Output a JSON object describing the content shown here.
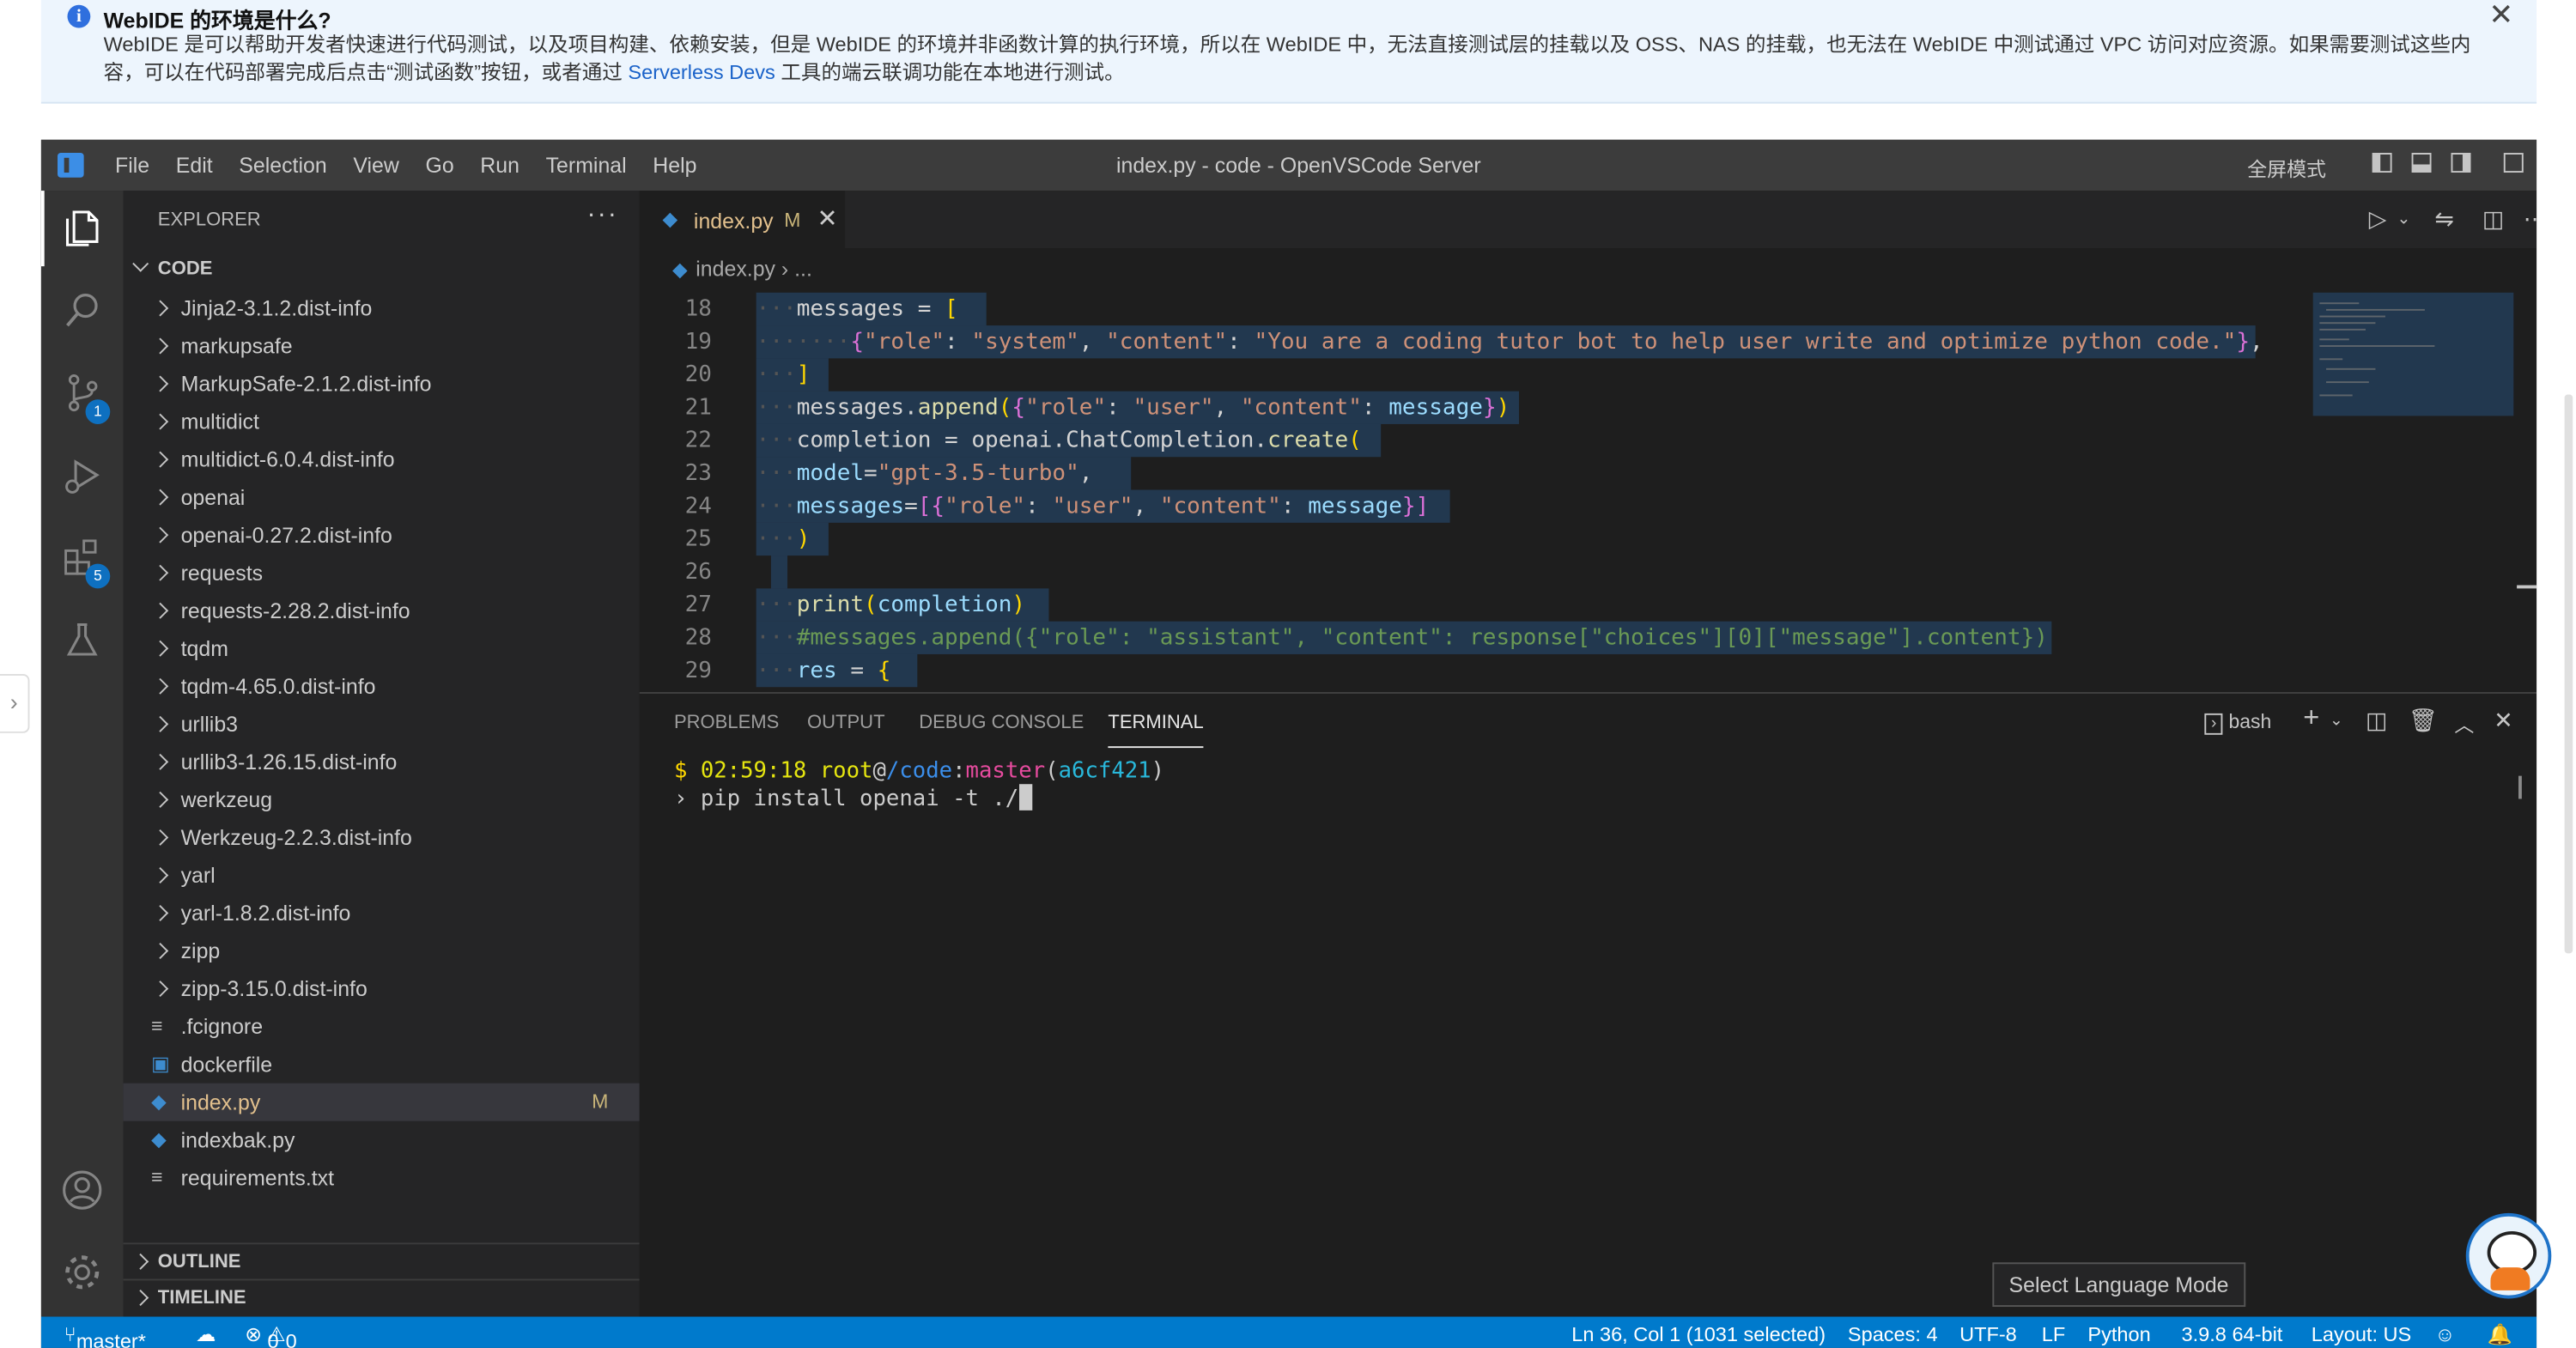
{
  "notice": {
    "title": "WebIDE 的环境是什么?",
    "text_before": "WebIDE 是可以帮助开发者快速进行代码测试，以及项目构建、依赖安装，但是 WebIDE 的环境并非函数计算的执行环境，所以在 WebIDE 中，无法直接测试层的挂载以及 OSS、NAS 的挂载，也无法在 WebIDE 中测试通过 VPC 访问对应资源。如果需要测试这些内容，可以在代码部署完成后点击“测试函数”按钮，或者通过",
    "link": "Serverless Devs",
    "text_after": "工具的端云联调功能在本地进行测试。"
  },
  "titlebar": {
    "menu": [
      "File",
      "Edit",
      "Selection",
      "View",
      "Go",
      "Run",
      "Terminal",
      "Help"
    ],
    "window_title": "index.py - code - OpenVSCode Server",
    "fullscreen": "全屏模式"
  },
  "activity_bar": {
    "scm_badge": "1",
    "extensions_badge": "5"
  },
  "explorer": {
    "title": "EXPLORER",
    "more": "···",
    "root": "CODE",
    "items": [
      {
        "name": "Jinja2-3.1.2.dist-info",
        "type": "folder"
      },
      {
        "name": "markupsafe",
        "type": "folder"
      },
      {
        "name": "MarkupSafe-2.1.2.dist-info",
        "type": "folder"
      },
      {
        "name": "multidict",
        "type": "folder"
      },
      {
        "name": "multidict-6.0.4.dist-info",
        "type": "folder"
      },
      {
        "name": "openai",
        "type": "folder"
      },
      {
        "name": "openai-0.27.2.dist-info",
        "type": "folder"
      },
      {
        "name": "requests",
        "type": "folder"
      },
      {
        "name": "requests-2.28.2.dist-info",
        "type": "folder"
      },
      {
        "name": "tqdm",
        "type": "folder"
      },
      {
        "name": "tqdm-4.65.0.dist-info",
        "type": "folder"
      },
      {
        "name": "urllib3",
        "type": "folder"
      },
      {
        "name": "urllib3-1.26.15.dist-info",
        "type": "folder"
      },
      {
        "name": "werkzeug",
        "type": "folder"
      },
      {
        "name": "Werkzeug-2.2.3.dist-info",
        "type": "folder"
      },
      {
        "name": "yarl",
        "type": "folder"
      },
      {
        "name": "yarl-1.8.2.dist-info",
        "type": "folder"
      },
      {
        "name": "zipp",
        "type": "folder"
      },
      {
        "name": "zipp-3.15.0.dist-info",
        "type": "folder"
      },
      {
        "name": ".fcignore",
        "type": "text"
      },
      {
        "name": "dockerfile",
        "type": "docker"
      },
      {
        "name": "index.py",
        "type": "python",
        "selected": true,
        "status": "M"
      },
      {
        "name": "indexbak.py",
        "type": "python"
      },
      {
        "name": "requirements.txt",
        "type": "text"
      }
    ],
    "outline": "OUTLINE",
    "timeline": "TIMELINE"
  },
  "editor": {
    "tab": {
      "label": "index.py",
      "status": "M",
      "close": "✕"
    },
    "breadcrumb": [
      "index.py",
      "..."
    ],
    "lines": [
      "18",
      "19",
      "20",
      "21",
      "22",
      "23",
      "24",
      "25",
      "26",
      "27",
      "28",
      "29"
    ]
  },
  "panel": {
    "tabs": [
      "PROBLEMS",
      "OUTPUT",
      "DEBUG CONSOLE",
      "TERMINAL"
    ],
    "active_tab": "TERMINAL",
    "shell": "bash",
    "prompt": {
      "dollar": "$",
      "time": "02:59:18",
      "user": "root",
      "at": "@",
      "path": "/code",
      "colon": ":",
      "branch": "master",
      "commit": "a6cf421"
    },
    "command": "pip install openai -t ./",
    "tooltip": "Select Language Mode"
  },
  "statusbar": {
    "branch": "master*",
    "errors": "0",
    "warnings": "0",
    "position": "Ln 36, Col 1 (1031 selected)",
    "spaces": "Spaces: 4",
    "encoding": "UTF-8",
    "eol": "LF",
    "language": "Python",
    "interpreter": "3.9.8 64-bit",
    "layout": "Layout: US"
  },
  "colors": {
    "accent": "#007acc",
    "titlebar": "#3c3c3c",
    "sidebar": "#252526",
    "editor": "#1e1e1e"
  }
}
